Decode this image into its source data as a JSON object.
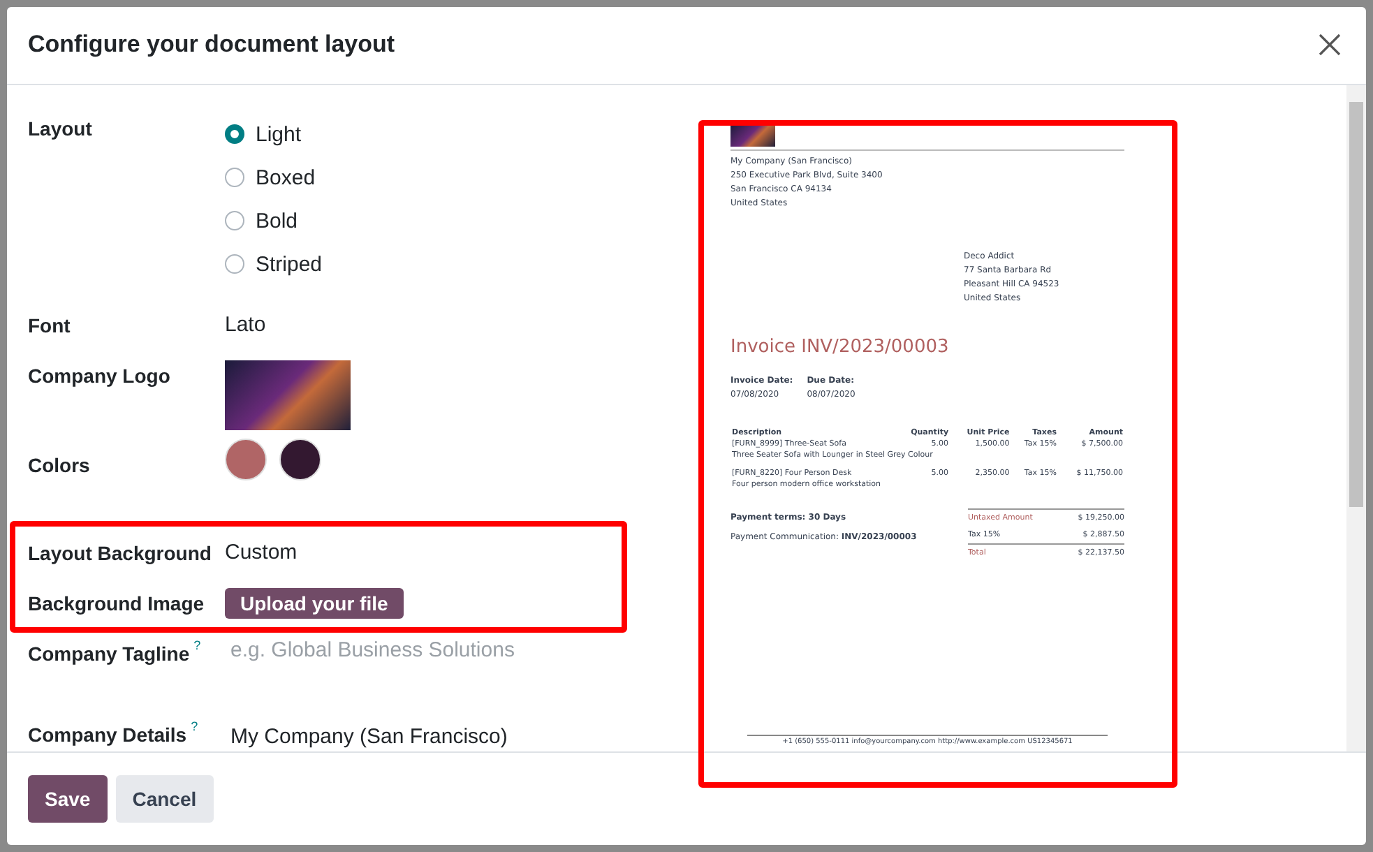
{
  "dialog": {
    "title": "Configure your document layout"
  },
  "fields": [
    {
      "kind": "radio",
      "label": "Layout",
      "highlighted": false,
      "options": [
        {
          "label": "Light",
          "selected": true
        },
        {
          "label": "Boxed",
          "selected": false
        },
        {
          "label": "Bold",
          "selected": false
        },
        {
          "label": "Striped",
          "selected": false
        }
      ]
    },
    {
      "kind": "text",
      "label": "Font",
      "highlighted": false,
      "value": "Lato"
    },
    {
      "kind": "logo",
      "label": "Company Logo",
      "highlighted": false
    },
    {
      "kind": "colors",
      "label": "Colors",
      "highlighted": false,
      "swatches": [
        {
          "color": "#b06566"
        },
        {
          "color": "#331830"
        }
      ]
    },
    {
      "kind": "text",
      "label": "Layout Background",
      "highlighted": true,
      "value": "Custom"
    },
    {
      "kind": "upload",
      "label": "Background Image",
      "highlighted": true,
      "button": "Upload your file"
    },
    {
      "kind": "input",
      "label": "Company Tagline",
      "help": "?",
      "highlighted": false,
      "placeholder": "e.g. Global Business Solutions"
    },
    {
      "kind": "textarea",
      "label": "Company Details",
      "help": "?",
      "highlighted": false,
      "value": "My Company (San Francisco)"
    }
  ],
  "preview": {
    "highlighted": true,
    "company_address": [
      "My Company (San Francisco)",
      "250 Executive Park Blvd, Suite 3400",
      "San Francisco CA 94134",
      "United States"
    ],
    "customer_address": [
      "Deco Addict",
      "77 Santa Barbara Rd",
      "Pleasant Hill CA 94523",
      "United States"
    ],
    "title": "Invoice INV/2023/00003",
    "dates": [
      {
        "label": "Invoice Date:",
        "value": "07/08/2020"
      },
      {
        "label": "Due Date:",
        "value": "08/07/2020"
      }
    ],
    "columns": [
      "Description",
      "Quantity",
      "Unit Price",
      "Taxes",
      "Amount"
    ],
    "rows": [
      {
        "cells": [
          "[FURN_8999] Three-Seat Sofa",
          "5.00",
          "1,500.00",
          "Tax 15%",
          "$ 7,500.00"
        ],
        "description": "Three Seater Sofa with Lounger in Steel Grey Colour"
      },
      {
        "cells": [
          "[FURN_8220] Four Person Desk",
          "5.00",
          "2,350.00",
          "Tax 15%",
          "$ 11,750.00"
        ],
        "description": "Four person modern office workstation"
      }
    ],
    "payment_terms": "Payment terms: 30 Days",
    "payment_communication": "Payment Communication: **INV/2023/00003**",
    "totals": [
      {
        "kind": "accent",
        "label": "Untaxed Amount",
        "value": "$ 19,250.00"
      },
      {
        "kind": "plain",
        "label": "Tax 15%",
        "value": "$ 2,887.50"
      },
      {
        "kind": "accent",
        "label": "Total",
        "value": "$ 22,137.50"
      }
    ],
    "footer": "+1 (650) 555-0111 info@yourcompany.com http://www.example.com US12345671"
  },
  "buttons": [
    {
      "label": "Save",
      "kind": "primary"
    },
    {
      "label": "Cancel",
      "kind": "secondary"
    }
  ]
}
